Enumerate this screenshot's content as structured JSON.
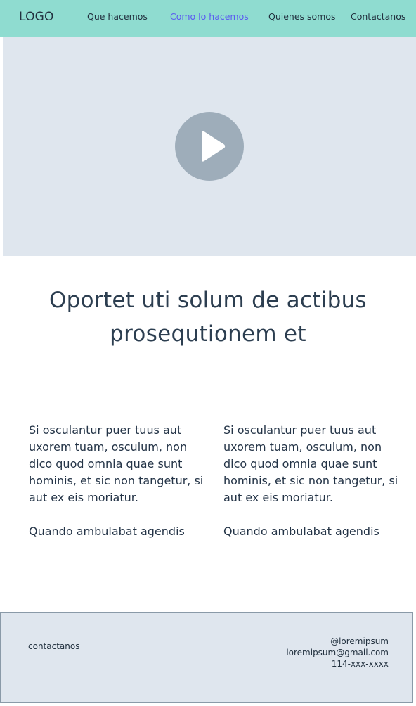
{
  "nav": {
    "logo": "LOGO",
    "links": [
      {
        "label": "Que hacemos"
      },
      {
        "label": "Como lo hacemos",
        "active": true
      },
      {
        "label": "Quienes somos"
      },
      {
        "label": "Contactanos"
      }
    ]
  },
  "video": {
    "play_icon": "play-icon"
  },
  "headline": "Oportet uti solum de actibus prosequtionem et",
  "columns": [
    {
      "paragraph": "Si osculantur puer tuus aut uxorem tuam, osculum, non dico quod omnia quae sunt hominis, et sic non tangetur, si aut ex eis moriatur.",
      "tagline": "Quando ambulabat agendis"
    },
    {
      "paragraph": "Si osculantur puer tuus aut uxorem tuam, osculum, non dico quod omnia quae sunt hominis, et sic non tangetur, si aut ex eis moriatur.",
      "tagline": "Quando ambulabat agendis"
    }
  ],
  "footer": {
    "label": "contactanos",
    "handle": "@loremipsum",
    "email": "loremipsum@gmail.com",
    "phone": "114-xxx-xxxx"
  },
  "colors": {
    "nav_bg": "#8fdcd0",
    "active_link": "#5b5bf0",
    "panel_bg": "#dfe6ee",
    "play_button": "#9eadba",
    "text": "#243447"
  }
}
